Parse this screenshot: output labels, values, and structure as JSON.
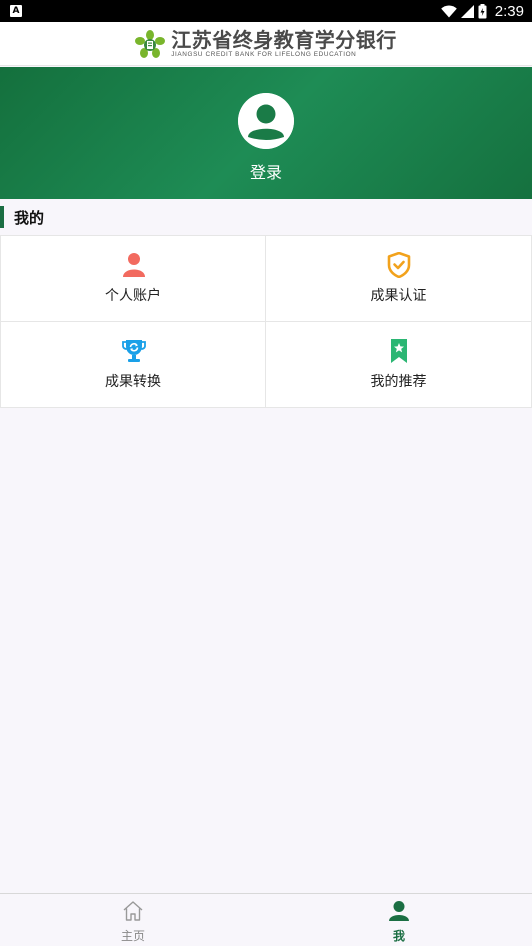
{
  "status_bar": {
    "app_badge": "A",
    "time": "2:39",
    "icons": [
      "wifi-icon",
      "signal-icon",
      "battery-icon"
    ]
  },
  "header": {
    "logo_title": "江苏省终身教育学分银行",
    "logo_subtitle": "JIANGSU CREDIT BANK FOR LIFELONG EDUCATION"
  },
  "profile": {
    "login_label": "登录"
  },
  "section": {
    "title": "我的"
  },
  "menu": [
    {
      "label": "个人账户",
      "icon": "person-icon",
      "color": "#f26a5f"
    },
    {
      "label": "成果认证",
      "icon": "shield-check-icon",
      "color": "#f2a21c"
    },
    {
      "label": "成果转换",
      "icon": "trophy-refresh-icon",
      "color": "#1aa0e8"
    },
    {
      "label": "我的推荐",
      "icon": "bookmark-star-icon",
      "color": "#2bb673"
    }
  ],
  "tabbar": {
    "tabs": [
      {
        "label": "主页",
        "icon": "home-icon",
        "active": false
      },
      {
        "label": "我",
        "icon": "person-icon",
        "active": true
      }
    ]
  },
  "colors": {
    "brand_green": "#1b6e43",
    "hero_gradient": [
      "#14703d",
      "#1e8c55"
    ]
  }
}
